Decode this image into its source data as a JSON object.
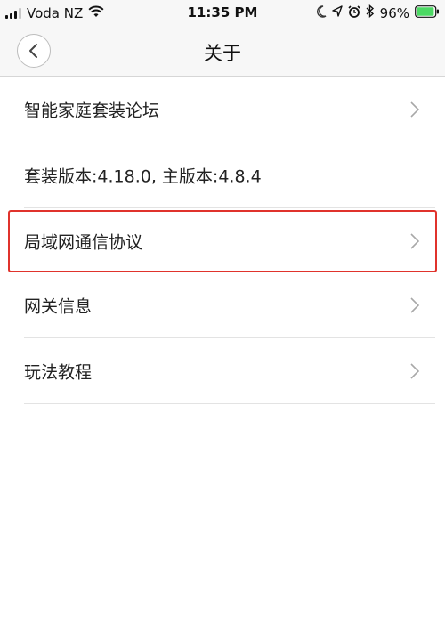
{
  "status_bar": {
    "carrier": "Voda NZ",
    "time": "11:35 PM",
    "battery_percent": "96%",
    "icons": [
      "signal-icon",
      "wifi-icon",
      "moon-icon",
      "location-icon",
      "alarm-icon",
      "bluetooth-icon",
      "battery-icon"
    ]
  },
  "nav": {
    "title": "关于",
    "back_icon": "chevron-left-icon"
  },
  "list": {
    "items": [
      {
        "label": "智能家庭套装论坛",
        "has_arrow": true
      },
      {
        "label": "套装版本:4.18.0, 主版本:4.8.4",
        "has_arrow": false
      },
      {
        "label": "局域网通信协议",
        "has_arrow": true,
        "highlighted": true
      },
      {
        "label": "网关信息",
        "has_arrow": true
      },
      {
        "label": "玩法教程",
        "has_arrow": true
      }
    ]
  },
  "colors": {
    "highlight_border": "#e0332c",
    "battery_fill": "#4cd964"
  }
}
